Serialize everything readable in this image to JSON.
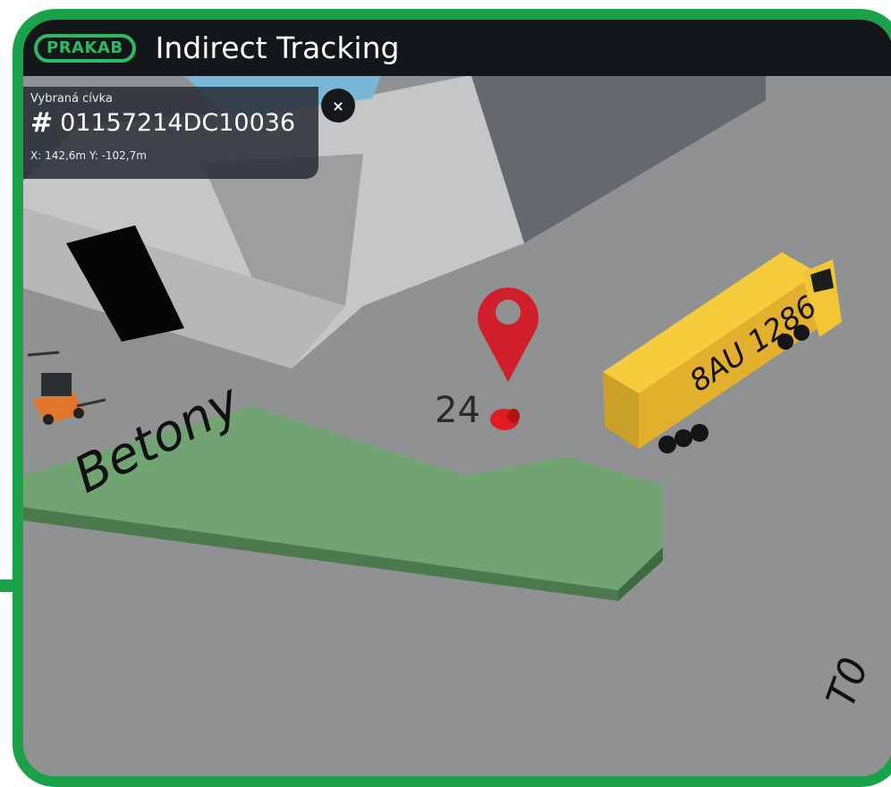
{
  "header": {
    "logo_text": "PRAKAB",
    "title": "Indirect Tracking"
  },
  "info_panel": {
    "label": "Vybraná cívka",
    "hash_symbol": "#",
    "coil_id": "01157214DC10036",
    "coords": "X: 142,6m Y: -102,7m",
    "close_symbol": "×"
  },
  "scene": {
    "zone_label": "Betony",
    "marker_number": "24",
    "truck_plate": "8AU 1286",
    "corner_label": "T0",
    "colors": {
      "accent": "#1aa24a",
      "marker": "#d01f2a",
      "truck": "#f0b82a",
      "zone": "#73a574"
    }
  }
}
